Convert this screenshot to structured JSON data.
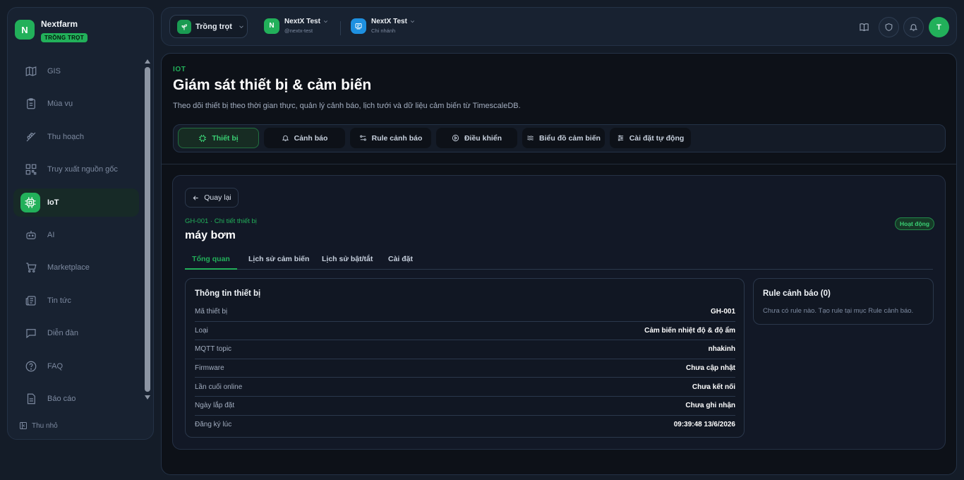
{
  "brand": {
    "logo_letter": "N",
    "name": "Nextfarm",
    "badge": "TRỒNG TRỌT"
  },
  "sidebar": {
    "items": [
      {
        "label": "GIS",
        "icon": "map-icon"
      },
      {
        "label": "Mùa vụ",
        "icon": "clipboard-icon"
      },
      {
        "label": "Thu hoạch",
        "icon": "wheat-icon"
      },
      {
        "label": "Truy xuất nguồn gốc",
        "icon": "qr-code-icon"
      },
      {
        "label": "IoT",
        "icon": "chip-icon",
        "active": true
      },
      {
        "label": "AI",
        "icon": "bot-icon"
      },
      {
        "label": "Marketplace",
        "icon": "cart-icon"
      },
      {
        "label": "Tin tức",
        "icon": "newspaper-icon"
      },
      {
        "label": "Diễn đàn",
        "icon": "chat-icon"
      },
      {
        "label": "FAQ",
        "icon": "help-circle-icon"
      },
      {
        "label": "Báo cáo",
        "icon": "report-icon"
      }
    ],
    "collapse_label": "Thu nhỏ"
  },
  "topbar": {
    "crop_select": "Trồng trọt",
    "org1": {
      "letter": "N",
      "name": "NextX Test",
      "sub": "@nextx-test"
    },
    "org2": {
      "name": "NextX Test",
      "sub": "Chi nhánh"
    },
    "avatar_letter": "T"
  },
  "header": {
    "eyebrow": "IOT",
    "title": "Giám sát thiết bị & cảm biến",
    "description": "Theo dõi thiết bị theo thời gian thực, quản lý cảnh báo, lịch tưới và dữ liệu cảm biến từ TimescaleDB."
  },
  "tabs": [
    {
      "label": "Thiết bị",
      "icon": "chip-icon",
      "active": true
    },
    {
      "label": "Cảnh báo",
      "icon": "bell-icon"
    },
    {
      "label": "Rule cảnh báo",
      "icon": "rule-icon"
    },
    {
      "label": "Điều khiển",
      "icon": "play-circle-icon"
    },
    {
      "label": "Biểu đồ cảm biến",
      "icon": "wave-icon"
    },
    {
      "label": "Cài đặt tự động",
      "icon": "sliders-icon"
    }
  ],
  "detail": {
    "back_label": "Quay lại",
    "breadcrumb": "GH-001 · Chi tiết thiết bị",
    "device_name": "máy bơm",
    "status": "Hoạt động",
    "sub_tabs": [
      "Tổng quan",
      "Lịch sử cảm biến",
      "Lịch sử bật/tắt",
      "Cài đặt"
    ],
    "info_title": "Thông tin thiết bị",
    "info_rows": [
      {
        "label": "Mã thiết bị",
        "value": "GH-001"
      },
      {
        "label": "Loại",
        "value": "Cảm biến nhiệt độ & độ ẩm"
      },
      {
        "label": "MQTT topic",
        "value": "nhakinh"
      },
      {
        "label": "Firmware",
        "value": "Chưa cập nhật"
      },
      {
        "label": "Lần cuối online",
        "value": "Chưa kết nối"
      },
      {
        "label": "Ngày lắp đặt",
        "value": "Chưa ghi nhận"
      },
      {
        "label": "Đăng ký lúc",
        "value": "09:39:48 13/6/2026"
      }
    ],
    "rule_title": "Rule cảnh báo (0)",
    "rule_empty": "Chưa có rule nào. Tạo rule tại mục Rule cảnh báo."
  },
  "colors": {
    "accent": "#22b05a",
    "background": "#0d1118",
    "panel": "#182231"
  }
}
